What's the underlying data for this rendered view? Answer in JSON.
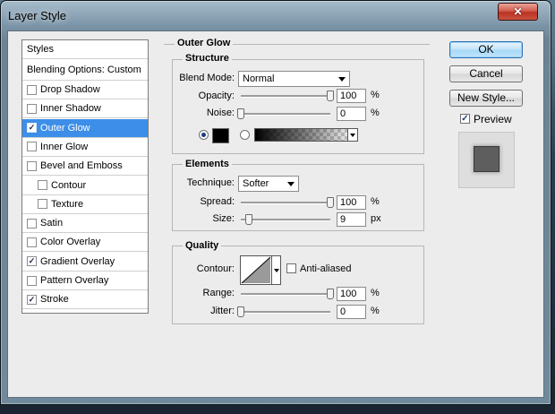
{
  "window": {
    "title": "Layer Style",
    "close_glyph": "✕"
  },
  "styles_list": {
    "header": "Styles",
    "blending": "Blending Options: Custom",
    "items": [
      {
        "label": "Drop Shadow",
        "checked": false
      },
      {
        "label": "Inner Shadow",
        "checked": false
      },
      {
        "label": "Outer Glow",
        "checked": true,
        "selected": true
      },
      {
        "label": "Inner Glow",
        "checked": false
      },
      {
        "label": "Bevel and Emboss",
        "checked": false
      },
      {
        "label": "Contour",
        "checked": false,
        "indent": true
      },
      {
        "label": "Texture",
        "checked": false,
        "indent": true
      },
      {
        "label": "Satin",
        "checked": false
      },
      {
        "label": "Color Overlay",
        "checked": false
      },
      {
        "label": "Gradient Overlay",
        "checked": true
      },
      {
        "label": "Pattern Overlay",
        "checked": false
      },
      {
        "label": "Stroke",
        "checked": true
      }
    ],
    "check_glyph": "✓"
  },
  "outer_glow": {
    "title": "Outer Glow",
    "structure": {
      "title": "Structure",
      "blend_mode_label": "Blend Mode:",
      "blend_mode": "Normal",
      "opacity_label": "Opacity:",
      "opacity": "100",
      "opacity_level": 1.0,
      "noise_label": "Noise:",
      "noise": "0",
      "noise_level": 0.0,
      "unit": "%",
      "fill_mode": "color",
      "glow_color": "#000000"
    },
    "elements": {
      "title": "Elements",
      "technique_label": "Technique:",
      "technique": "Softer",
      "spread_label": "Spread:",
      "spread": "100",
      "spread_level": 1.0,
      "spread_unit": "%",
      "size_label": "Size:",
      "size": "9",
      "size_level": 0.09,
      "size_unit": "px"
    },
    "quality": {
      "title": "Quality",
      "contour_label": "Contour:",
      "anti_aliased_label": "Anti-aliased",
      "anti_aliased": false,
      "range_label": "Range:",
      "range": "100",
      "range_level": 1.0,
      "range_unit": "%",
      "jitter_label": "Jitter:",
      "jitter": "0",
      "jitter_level": 0.0,
      "jitter_unit": "%"
    }
  },
  "buttons": {
    "ok": "OK",
    "cancel": "Cancel",
    "new_style": "New Style..."
  },
  "preview": {
    "label": "Preview",
    "checked": true
  }
}
